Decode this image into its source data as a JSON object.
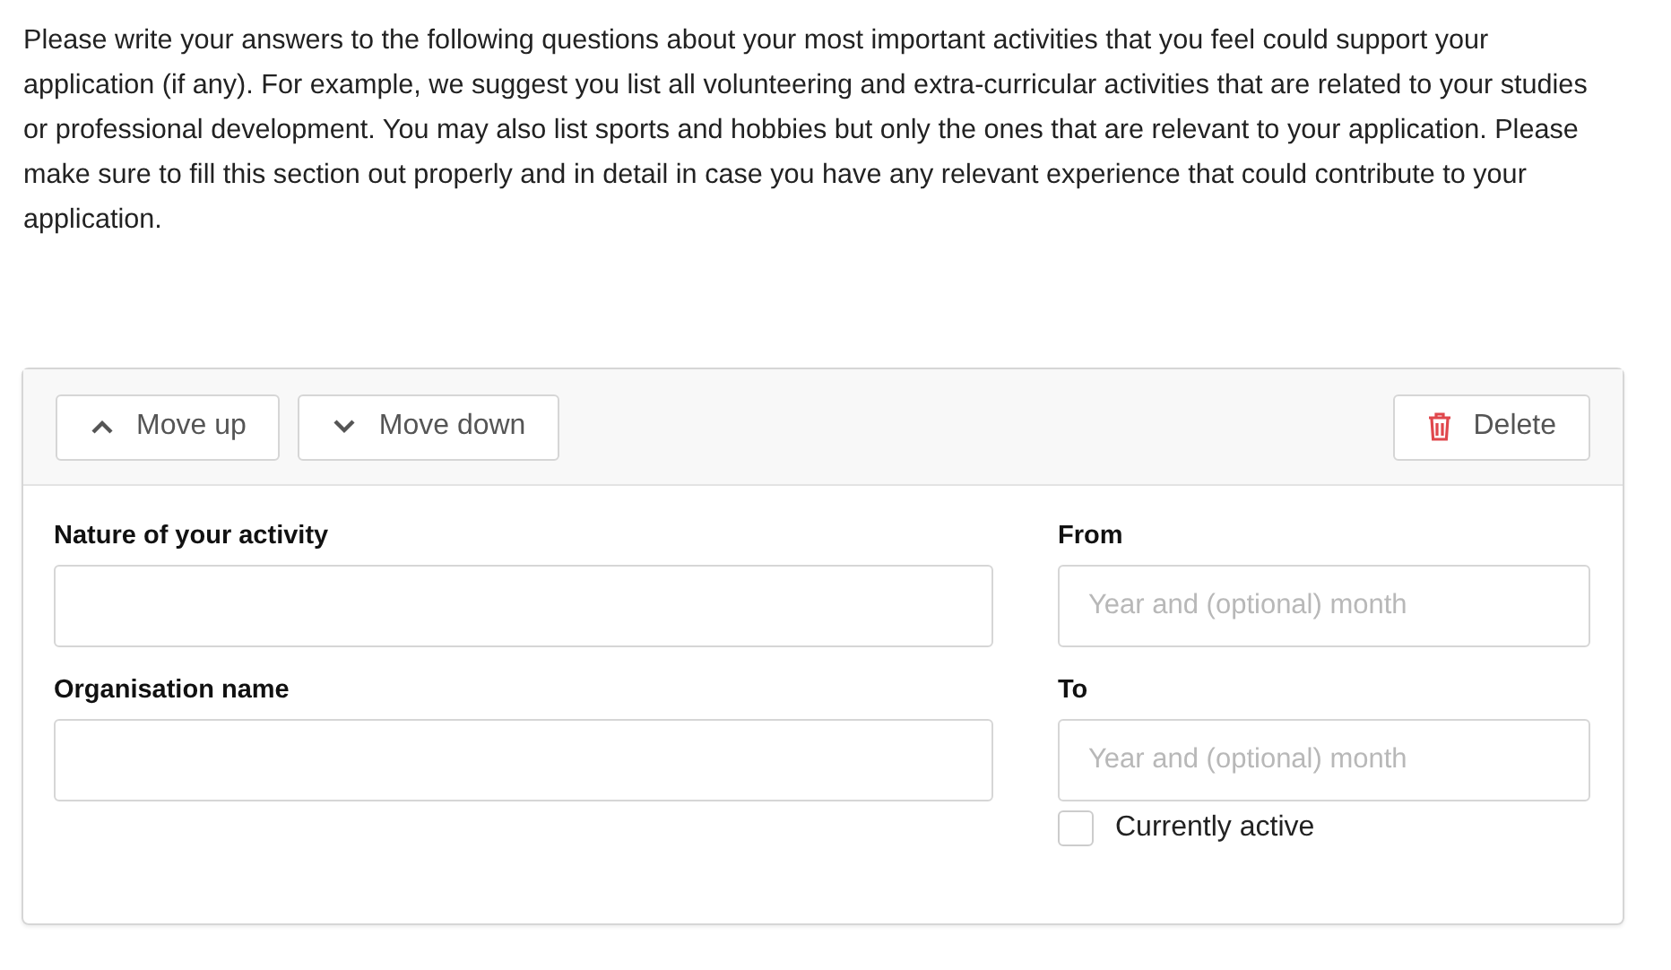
{
  "intro": "Please write your answers to the following questions about your most important activities that you feel could support your application (if any). For example, we suggest you list all volunteering and extra-curricular activities that are related to your studies or professional development. You may also list sports and hobbies but only the ones that are relevant to your application. Please make sure to fill this section out properly and in detail in case you have any relevant experience that could contribute to your application.",
  "toolbar": {
    "move_up": "Move up",
    "move_down": "Move down",
    "delete": "Delete"
  },
  "left_fields": [
    {
      "label": "Nature of your activity"
    },
    {
      "label": "Organisation name"
    }
  ],
  "right_fields": [
    {
      "label": "From",
      "placeholder": "Year and (optional) month"
    },
    {
      "label": "To",
      "placeholder": "Year and (optional) month"
    }
  ],
  "currently_active": {
    "label": "Currently active",
    "checked": false
  }
}
